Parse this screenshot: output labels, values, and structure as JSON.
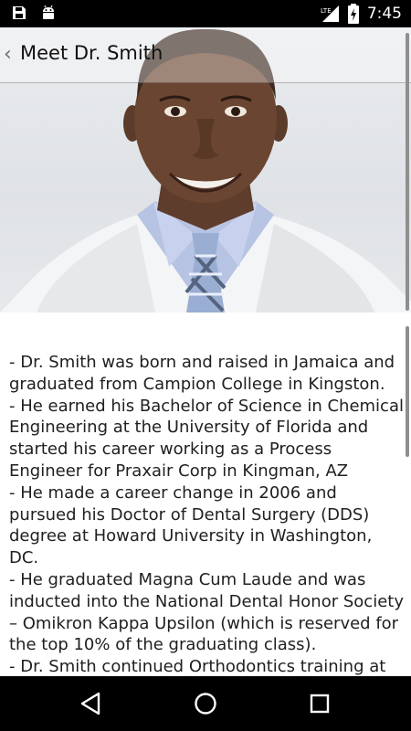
{
  "status_bar": {
    "time": "7:45",
    "network_label": "LTE",
    "icons": [
      "save-icon",
      "android-icon",
      "signal-icon",
      "battery-charging-icon"
    ]
  },
  "header": {
    "title": "Meet Dr. Smith",
    "back_icon": "chevron-left-icon"
  },
  "photo": {
    "subject": "portrait-photo"
  },
  "bio": {
    "lines": [
      "- Dr. Smith was born and raised in Jamaica and graduated from Campion College in Kingston.",
      "- He earned his Bachelor of Science in Chemical Engineering at the University of Florida and started his career working as a Process Engineer for Praxair Corp in Kingman, AZ",
      "- He made a career change in 2006 and pursued his Doctor of Dental Surgery (DDS) degree at Howard University in Washington, DC.",
      "- He graduated Magna Cum Laude and was inducted into the National Dental Honor Society – Omikron Kappa Upsilon (which is reserved for the top 10% of the graduating class).",
      "- Dr. Smith continued Orthodontics training at Howard University and submitted research to"
    ]
  },
  "nav_bar": {
    "buttons": [
      "back-icon",
      "home-icon",
      "recents-icon"
    ]
  },
  "colors": {
    "status_bar_bg": "#000000",
    "text": "#202020",
    "scrollbar": "#8f8f8f"
  }
}
